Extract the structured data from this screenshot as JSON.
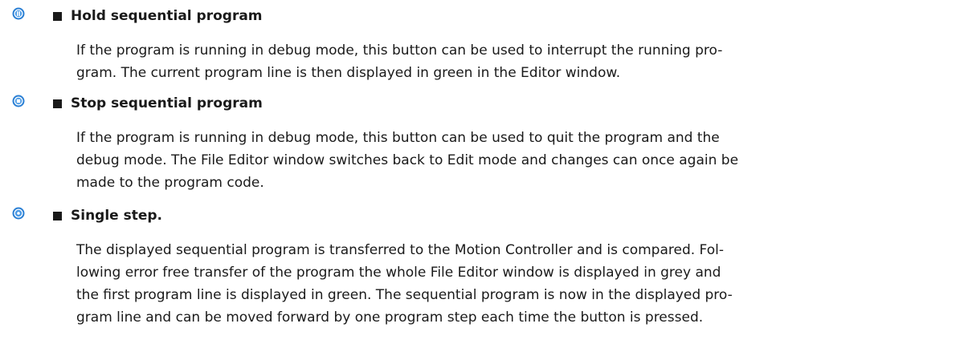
{
  "items": [
    {
      "icon": "pause-icon",
      "title": "Hold sequential program",
      "lines": [
        "If the program is running in debug mode, this button can be used to interrupt the running pro-",
        "gram. The current program line is then displayed in green in the Editor window."
      ]
    },
    {
      "icon": "stop-icon",
      "title": "Stop sequential program",
      "lines": [
        "If the program is running in debug mode, this button can be used to quit the program and the",
        "debug mode. The File Editor window switches back to Edit mode and changes can once again be",
        "made to the program code."
      ]
    },
    {
      "icon": "single-step-icon",
      "title": "Single step.",
      "lines": [
        "The displayed sequential program is transferred to the Motion Controller and is compared. Fol-",
        "lowing error free transfer of the program the whole File Editor window is displayed in grey and",
        "the first program line is displayed in green. The sequential program is now in the displayed pro-",
        "gram line and can be moved forward by one program step each time the button is pressed."
      ]
    }
  ],
  "colors": {
    "icon_ring": "#2a7fd4",
    "icon_inner": "#ffffff",
    "text": "#1a1a1a"
  }
}
